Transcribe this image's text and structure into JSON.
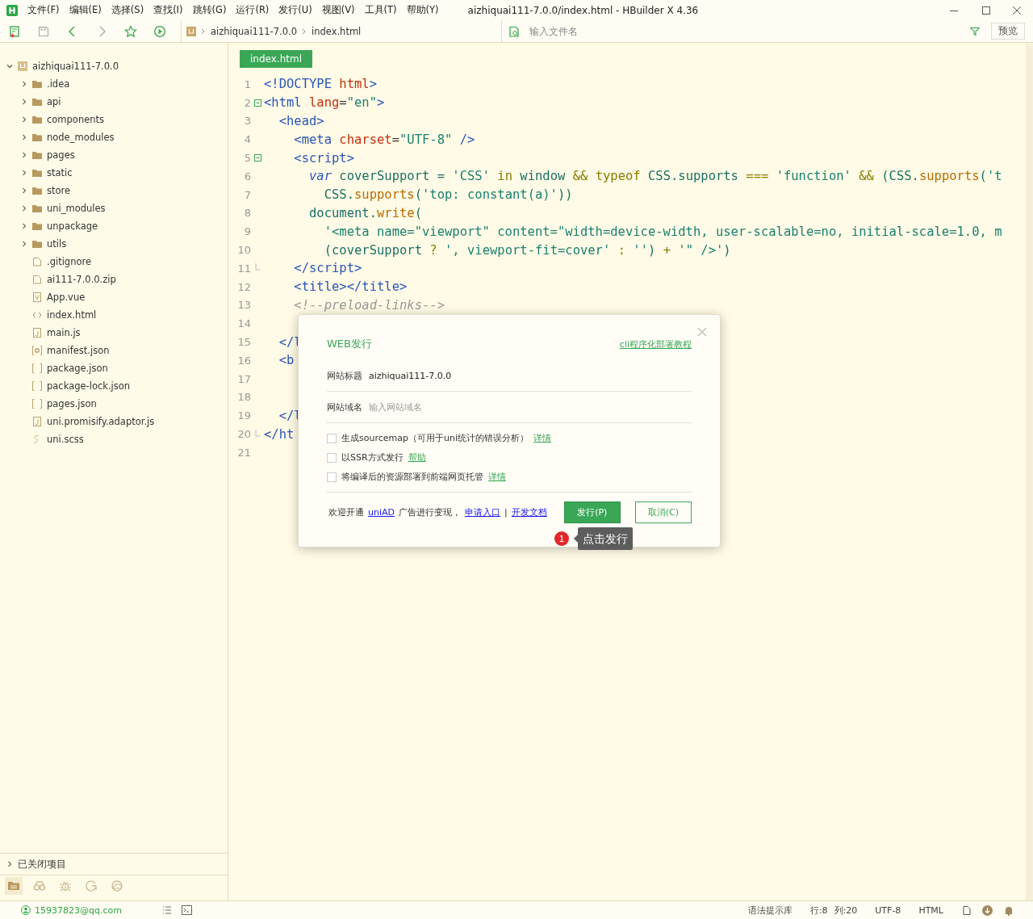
{
  "window": {
    "title": "aizhiquai111-7.0.0/index.html - HBuilder X 4.36"
  },
  "menu": [
    "文件(F)",
    "编辑(E)",
    "选择(S)",
    "查找(I)",
    "跳转(G)",
    "运行(R)",
    "发行(U)",
    "视图(V)",
    "工具(T)",
    "帮助(Y)"
  ],
  "toolbar": {
    "buttons": [
      {
        "kind": "new",
        "disabled": false
      },
      {
        "kind": "save",
        "disabled": true
      },
      {
        "kind": "back",
        "disabled": false
      },
      {
        "kind": "forward",
        "disabled": true
      },
      {
        "kind": "favorite",
        "disabled": false
      },
      {
        "kind": "run",
        "disabled": false
      }
    ],
    "breadcrumb": [
      "aizhiquai111-7.0.0",
      "index.html"
    ],
    "file_search": {
      "placeholder": "输入文件名"
    },
    "preview_button": "预览"
  },
  "project_tree": {
    "label": "aizhiquai111-7.0.0",
    "kind": "project",
    "expanded": true,
    "children": [
      {
        "label": ".idea",
        "kind": "folder",
        "expanded": false
      },
      {
        "label": "api",
        "kind": "folder",
        "expanded": false
      },
      {
        "label": "components",
        "kind": "folder",
        "expanded": false
      },
      {
        "label": "node_modules",
        "kind": "folder",
        "expanded": false
      },
      {
        "label": "pages",
        "kind": "folder",
        "expanded": false
      },
      {
        "label": "static",
        "kind": "folder",
        "expanded": false
      },
      {
        "label": "store",
        "kind": "folder",
        "expanded": false
      },
      {
        "label": "uni_modules",
        "kind": "folder",
        "expanded": false
      },
      {
        "label": "unpackage",
        "kind": "folder",
        "expanded": false
      },
      {
        "label": "utils",
        "kind": "folder",
        "expanded": false
      },
      {
        "label": ".gitignore",
        "kind": "file"
      },
      {
        "label": "ai111-7.0.0.zip",
        "kind": "file"
      },
      {
        "label": "App.vue",
        "kind": "vue"
      },
      {
        "label": "index.html",
        "kind": "html"
      },
      {
        "label": "main.js",
        "kind": "js"
      },
      {
        "label": "manifest.json",
        "kind": "config"
      },
      {
        "label": "package.json",
        "kind": "json"
      },
      {
        "label": "package-lock.json",
        "kind": "json"
      },
      {
        "label": "pages.json",
        "kind": "json"
      },
      {
        "label": "uni.promisify.adaptor.js",
        "kind": "js"
      },
      {
        "label": "uni.scss",
        "kind": "scss"
      }
    ]
  },
  "closed_projects": {
    "label": "已关闭项目",
    "expanded": false
  },
  "sidebar_tabs": [
    {
      "kind": "files",
      "selected": true
    },
    {
      "kind": "search",
      "selected": false
    },
    {
      "kind": "debug",
      "selected": false
    },
    {
      "kind": "git",
      "selected": false
    },
    {
      "kind": "cloud",
      "selected": false
    }
  ],
  "editor": {
    "tabs": [
      {
        "label": "index.html",
        "selected": true
      }
    ],
    "lines": [
      {
        "number": "1",
        "tokens": [
          {
            "kind": "tag",
            "text": "<!DOCTYPE "
          },
          {
            "kind": "name",
            "text": "html"
          },
          {
            "kind": "tag",
            "text": ">"
          }
        ]
      },
      {
        "number": "2",
        "foldable": true,
        "tokens": [
          {
            "kind": "tag",
            "text": "<html "
          },
          {
            "kind": "name",
            "text": "lang"
          },
          {
            "kind": "plain",
            "text": "="
          },
          {
            "kind": "string",
            "text": "\"en\""
          },
          {
            "kind": "tag",
            "text": ">"
          }
        ]
      },
      {
        "number": "3",
        "tokens": [
          {
            "kind": "tag",
            "text": "  <head>"
          }
        ]
      },
      {
        "number": "4",
        "tokens": [
          {
            "kind": "tag",
            "text": "    <meta"
          },
          {
            "kind": "name",
            "text": " charset"
          },
          {
            "kind": "plain",
            "text": "="
          },
          {
            "kind": "string",
            "text": "\"UTF-8\""
          },
          {
            "kind": "tag",
            "text": " />"
          }
        ]
      },
      {
        "number": "5",
        "foldable": true,
        "tokens": [
          {
            "kind": "tag",
            "text": "    <script>"
          }
        ]
      },
      {
        "number": "6",
        "tokens": [
          {
            "kind": "var",
            "text": "      var"
          },
          {
            "kind": "ident",
            "text": " coverSupport = "
          },
          {
            "kind": "string",
            "text": "'CSS'"
          },
          {
            "kind": "keyword",
            "text": " in "
          },
          {
            "kind": "ident",
            "text": "window "
          },
          {
            "kind": "keyword",
            "text": "&& typeof"
          },
          {
            "kind": "ident",
            "text": " CSS.supports "
          },
          {
            "kind": "keyword",
            "text": "==="
          },
          {
            "kind": "string",
            "text": " 'function'"
          },
          {
            "kind": "keyword",
            "text": " && "
          },
          {
            "kind": "ident",
            "text": "(CSS."
          },
          {
            "kind": "func",
            "text": "supports"
          },
          {
            "kind": "ident",
            "text": "("
          },
          {
            "kind": "string",
            "text": "'t"
          }
        ]
      },
      {
        "number": "7",
        "tokens": [
          {
            "kind": "ident",
            "text": "        CSS."
          },
          {
            "kind": "func",
            "text": "supports"
          },
          {
            "kind": "ident",
            "text": "("
          },
          {
            "kind": "string",
            "text": "'top: constant(a)'"
          },
          {
            "kind": "ident",
            "text": "))"
          }
        ]
      },
      {
        "number": "8",
        "tokens": [
          {
            "kind": "ident",
            "text": "      document."
          },
          {
            "kind": "func",
            "text": "write"
          },
          {
            "kind": "ident",
            "text": "("
          }
        ]
      },
      {
        "number": "9",
        "tokens": [
          {
            "kind": "string",
            "text": "        '<meta name=\"viewport\" content=\"width=device-width, user-scalable=no, initial-scale=1.0, m"
          }
        ]
      },
      {
        "number": "10",
        "tokens": [
          {
            "kind": "ident",
            "text": "        (coverSupport "
          },
          {
            "kind": "keyword",
            "text": "?"
          },
          {
            "kind": "string",
            "text": " ', viewport-fit=cover'"
          },
          {
            "kind": "keyword",
            "text": " : "
          },
          {
            "kind": "string",
            "text": "''"
          },
          {
            "kind": "ident",
            "text": ") "
          },
          {
            "kind": "keyword",
            "text": "+"
          },
          {
            "kind": "string",
            "text": " '\" />'"
          },
          {
            "kind": "ident",
            "text": ")"
          }
        ]
      },
      {
        "number": "11",
        "block_end": true,
        "tokens": [
          {
            "kind": "tag",
            "text": "    </script>"
          }
        ]
      },
      {
        "number": "12",
        "tokens": [
          {
            "kind": "tag",
            "text": "    <title></title>"
          }
        ]
      },
      {
        "number": "13",
        "tokens": [
          {
            "kind": "comment",
            "text": "    <!--preload-links-->"
          }
        ]
      },
      {
        "number": "14"
      },
      {
        "number": "15",
        "tokens": [
          {
            "kind": "tag",
            "text": "  </l"
          }
        ]
      },
      {
        "number": "16",
        "tokens": [
          {
            "kind": "tag",
            "text": "  <b"
          }
        ]
      },
      {
        "number": "17"
      },
      {
        "number": "18"
      },
      {
        "number": "19",
        "tokens": [
          {
            "kind": "tag",
            "text": "  </l"
          }
        ]
      },
      {
        "number": "20",
        "block_end": true,
        "tokens": [
          {
            "kind": "tag",
            "text": "</ht"
          }
        ]
      },
      {
        "number": "21"
      }
    ]
  },
  "dialog": {
    "title": "WEB发行",
    "help_link": "cli程序化部署教程",
    "fields": [
      {
        "label": "网站标题",
        "value": "aizhiquai111-7.0.0"
      },
      {
        "label": "网站域名",
        "placeholder": "输入网站域名"
      }
    ],
    "options": [
      {
        "label": "生成sourcemap（可用于uni统计的错误分析）",
        "checked": false,
        "link": "详情"
      },
      {
        "label": "以SSR方式发行",
        "checked": false,
        "link": "帮助"
      },
      {
        "label": "将编译后的资源部署到前端网页托管",
        "checked": false,
        "link": "详情"
      }
    ],
    "notice": [
      {
        "kind": "text",
        "text": "欢迎开通"
      },
      {
        "kind": "link",
        "text": "uniAD"
      },
      {
        "kind": "text",
        "text": "广告进行变现，"
      },
      {
        "kind": "link",
        "text": "申请入口"
      },
      {
        "kind": "text",
        "text": "|"
      },
      {
        "kind": "link",
        "text": "开发文档"
      }
    ],
    "buttons": [
      {
        "label": "发行(P)",
        "kind": "primary"
      },
      {
        "label": "取消(C)",
        "kind": "secondary"
      }
    ]
  },
  "tooltip": {
    "badge": "1",
    "text": "点击发行"
  },
  "status_bar": {
    "account": "15937823@qq.com",
    "right": [
      "语法提示库",
      "行:8",
      "列:20",
      "UTF-8",
      "HTML"
    ]
  }
}
